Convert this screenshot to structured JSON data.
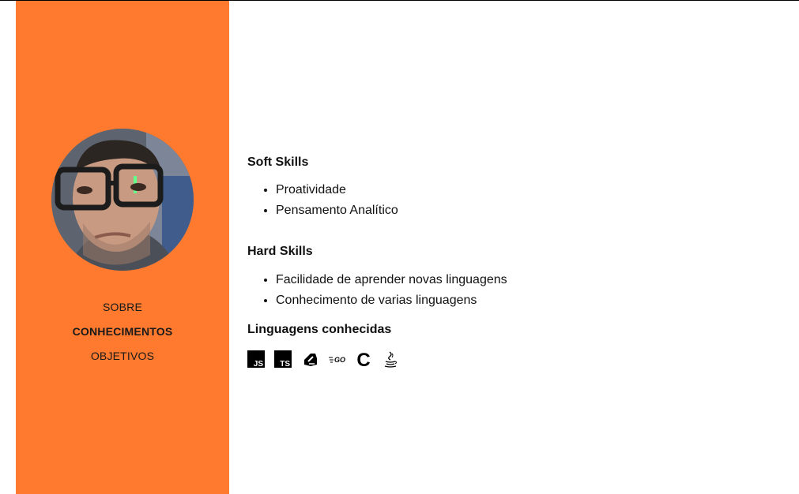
{
  "sidebar": {
    "background": "#ff7a2e",
    "avatar_alt": "profile-photo",
    "nav": [
      {
        "label": "SOBRE",
        "active": false
      },
      {
        "label": "CONHECIMENTOS",
        "active": true
      },
      {
        "label": "OBJETIVOS",
        "active": false
      }
    ]
  },
  "main": {
    "soft_skills": {
      "title": "Soft Skills",
      "items": [
        "Proatividade",
        "Pensamento Analítico"
      ]
    },
    "hard_skills": {
      "title": "Hard Skills",
      "items": [
        "Facilidade de aprender novas linguagens",
        "Conhecimento de varias linguagens"
      ]
    },
    "languages": {
      "title": "Linguagens conhecidas",
      "icons": [
        {
          "name": "javascript-icon",
          "text": "JS"
        },
        {
          "name": "typescript-icon",
          "text": "TS"
        },
        {
          "name": "dart-icon",
          "text": ""
        },
        {
          "name": "go-icon",
          "text": "GO"
        },
        {
          "name": "c-icon",
          "text": "C"
        },
        {
          "name": "java-icon",
          "text": ""
        }
      ]
    }
  }
}
